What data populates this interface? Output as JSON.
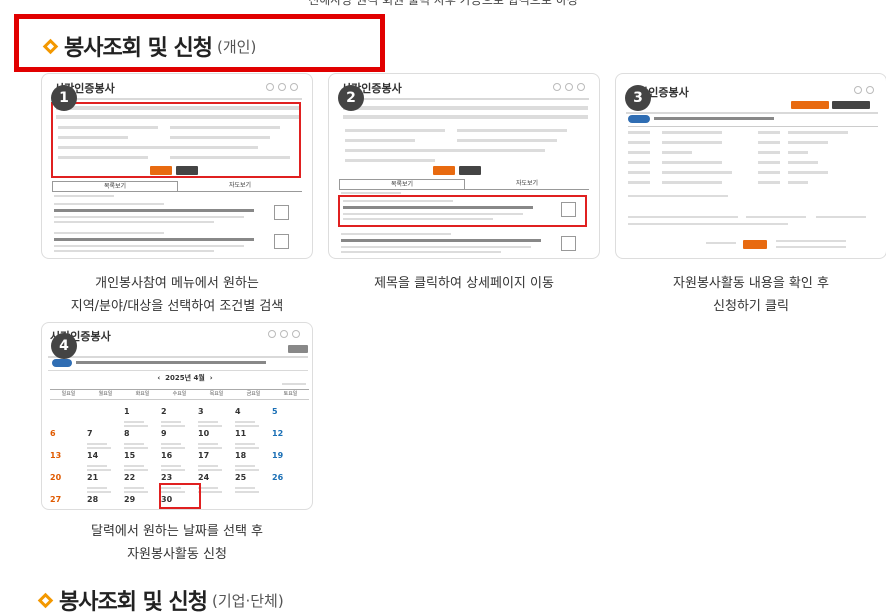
{
  "top_text": "진해사랑 원격 회원 출력 차후 가공으로 합격으로 하정",
  "section1": {
    "title": "봉사조회 및 신청",
    "sub": "(개인)"
  },
  "section2": {
    "title": "봉사조회 및 신청",
    "sub": "(기업·단체)"
  },
  "steps": [
    {
      "num": "1",
      "screen_title": "시간인증봉사",
      "caption_line1": "개인봉사참여 메뉴에서 원하는",
      "caption_line2": "지역/분야/대상을 선택하여 조건별 검색"
    },
    {
      "num": "2",
      "screen_title": "시간인증봉사",
      "caption_line1": "제목을 클릭하여 상세페이지 이동",
      "caption_line2": ""
    },
    {
      "num": "3",
      "screen_title": "시간인증봉사",
      "caption_line1": "자원봉사활동 내용을 확인 후",
      "caption_line2": "신청하기 클릭"
    },
    {
      "num": "4",
      "screen_title": "시간인증봉사",
      "caption_line1": "달력에서 원하는 날짜를 선택 후",
      "caption_line2": "자원봉사활동 신청"
    }
  ],
  "card1": {
    "tab_list": "목록보기",
    "tab_cal": "자도보기"
  },
  "card2": {
    "tab_list": "목록보기",
    "tab_cal": "자도보기"
  },
  "card4": {
    "month": "2025년 4월",
    "weekdays": [
      "일요일",
      "월요일",
      "화요일",
      "수요일",
      "목요일",
      "금요일",
      "토요일"
    ],
    "weeks": [
      [
        "",
        "",
        "1",
        "2",
        "3",
        "4",
        "5"
      ],
      [
        "6",
        "7",
        "8",
        "9",
        "10",
        "11",
        "12"
      ],
      [
        "13",
        "14",
        "15",
        "16",
        "17",
        "18",
        "19"
      ],
      [
        "20",
        "21",
        "22",
        "23",
        "24",
        "25",
        "26"
      ],
      [
        "27",
        "28",
        "29",
        "30",
        "",
        "",
        ""
      ]
    ]
  },
  "colors": {
    "accent_red": "#e10000",
    "diamond": "#f39800",
    "button_orange": "#e86a10"
  }
}
